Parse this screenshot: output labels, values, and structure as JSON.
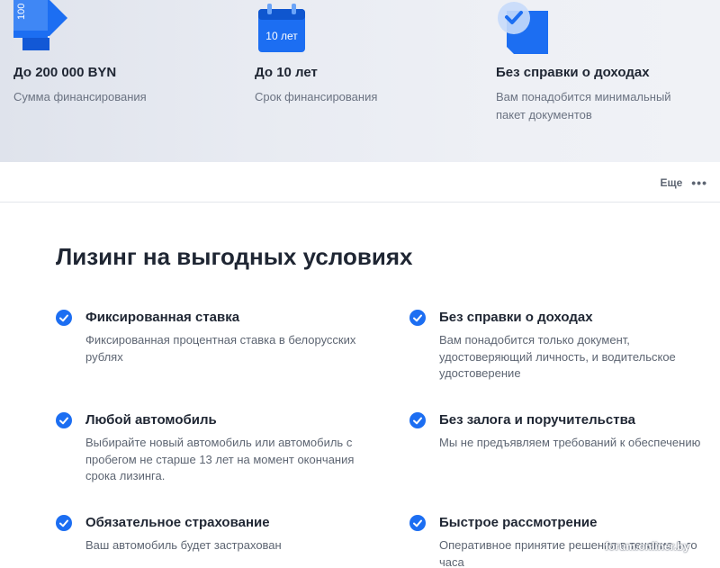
{
  "hero": {
    "features": [
      {
        "icon": "money-stack-icon",
        "icon_text": "100",
        "title": "До 200 000 BYN",
        "subtitle": "Сумма финансирования"
      },
      {
        "icon": "calendar-icon",
        "icon_text": "10 лет",
        "title": "До 10 лет",
        "subtitle": "Срок финансирования"
      },
      {
        "icon": "document-check-icon",
        "title": "Без справки о доходах",
        "subtitle": "Вам понадобится минимальный пакет документов"
      }
    ]
  },
  "more": {
    "label": "Еще",
    "icon": "more-dots-icon"
  },
  "section": {
    "title": "Лизинг на выгодных условиях",
    "items": [
      {
        "title": "Фиксированная ставка",
        "desc": "Фиксированная процентная ставка в белорусских рублях"
      },
      {
        "title": "Без справки о доходах",
        "desc": "Вам понадобится только документ, удостоверяющий личность, и водительское удостоверение"
      },
      {
        "title": "Любой автомобиль",
        "desc": "Выбирайте новый автомобиль или автомобиль с пробегом не старше 13 лет на момент окончания срока лизинга."
      },
      {
        "title": "Без залога и поручительства",
        "desc": "Мы не предъявляем требований к обеспечению"
      },
      {
        "title": "Обязательное страхование",
        "desc": "Ваш автомобиль будет застрахован"
      },
      {
        "title": "Быстрое рассмотрение",
        "desc": "Оперативное принятие решения в течение 1-го часа"
      }
    ]
  },
  "watermark": "forum.onliner.by",
  "colors": {
    "accent": "#1c6ef2",
    "hero_bg": "#e8ebf2",
    "text": "#1f2633",
    "muted": "#5d6572"
  }
}
